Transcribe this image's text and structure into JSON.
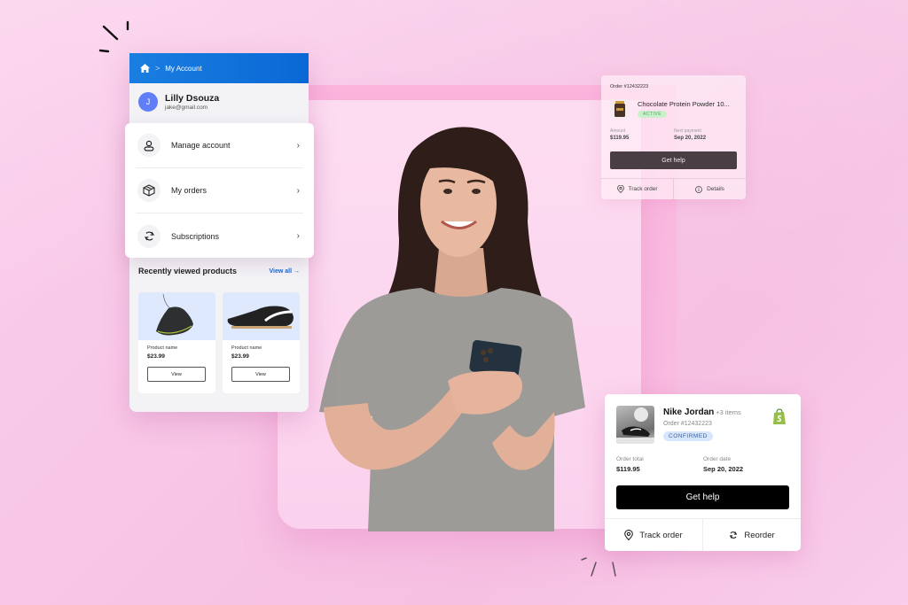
{
  "colors": {
    "background": "#f8c6e6",
    "account_header": "#0a68d6",
    "avatar": "#5f7ef7",
    "view_all_link": "#1b63c7",
    "active_badge_bg": "#c8f0cb",
    "confirmed_badge_bg": "#d6e6fd",
    "shopify_green": "#95bf47"
  },
  "account_card": {
    "breadcrumb": {
      "home_icon": "home-icon",
      "separator": ">",
      "current": "My Account"
    },
    "user": {
      "avatar_initial": "J",
      "name": "Lilly Dsouza",
      "email": "jake@gmail.com"
    },
    "menu": [
      {
        "label": "Manage account",
        "icon": "user-icon"
      },
      {
        "label": "My orders",
        "icon": "box-icon"
      },
      {
        "label": "Subscriptions",
        "icon": "refresh-icon"
      }
    ],
    "recent": {
      "title": "Recently viewed products",
      "view_all": "View all",
      "products": [
        {
          "name": "Product name",
          "price": "$23.99",
          "button": "View"
        },
        {
          "name": "Product name",
          "price": "$23.99",
          "button": "View"
        }
      ]
    }
  },
  "subscription_card": {
    "order_number": "Order #12432223",
    "product_title": "Chocolate Protein Powder 10...",
    "status": "ACTIVE",
    "amount_label": "Amount",
    "amount_value": "$119.95",
    "next_payment_label": "Next payment",
    "next_payment_value": "Sep 20, 2022",
    "help_button": "Get help",
    "track_label": "Track order",
    "details_label": "Details"
  },
  "order_card": {
    "product": "Nike Jordan",
    "extra_items": "+3 items",
    "order_number": "Order #12432223",
    "status": "CONFIRMED",
    "total_label": "Order total",
    "total_value": "$119.95",
    "date_label": "Order date",
    "date_value": "Sep 20, 2022",
    "help_button": "Get help",
    "track_label": "Track order",
    "reorder_label": "Reorder"
  }
}
